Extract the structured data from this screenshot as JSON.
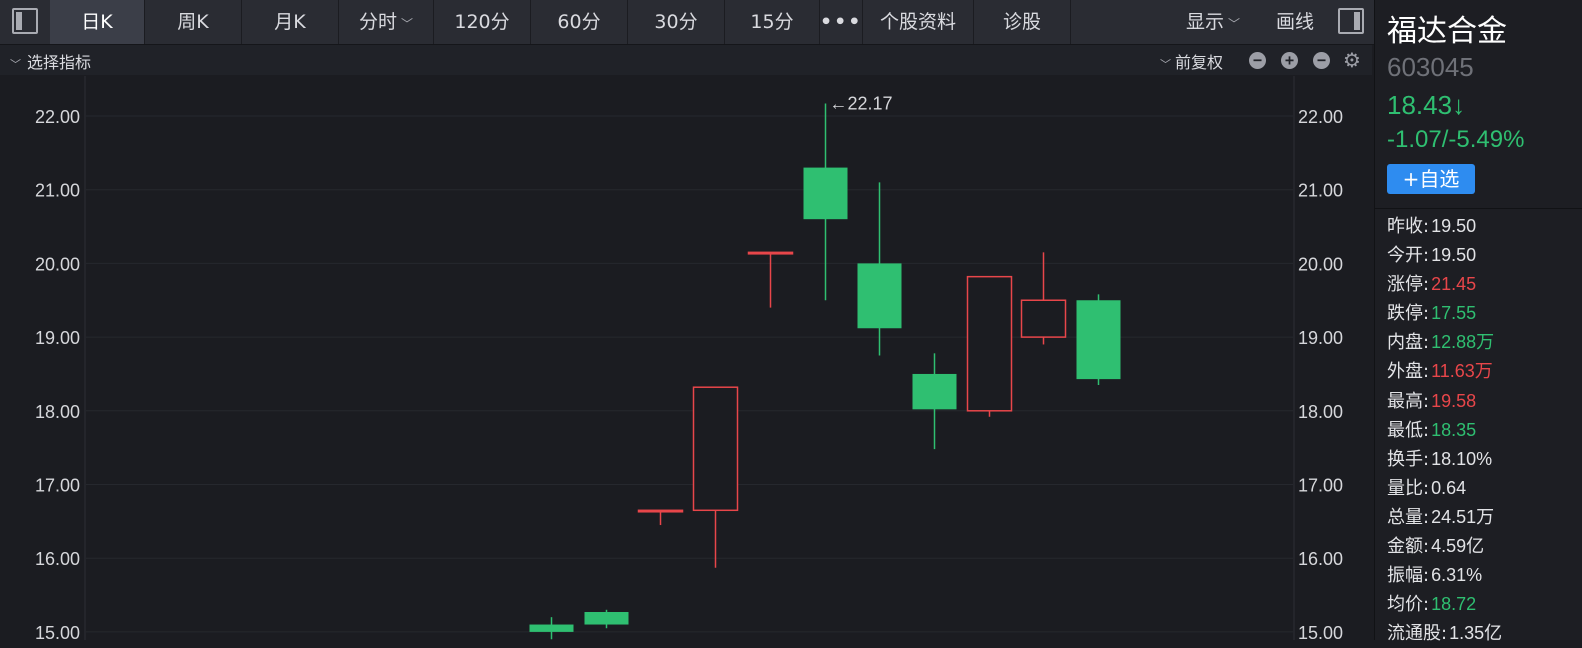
{
  "toolbar": {
    "tabs": [
      {
        "label": "日K"
      },
      {
        "label": "周K"
      },
      {
        "label": "月K"
      },
      {
        "label": "分时"
      },
      {
        "label": "120分"
      },
      {
        "label": "60分"
      },
      {
        "label": "30分"
      },
      {
        "label": "15分"
      },
      {
        "label": "•••"
      },
      {
        "label": "个股资料"
      },
      {
        "label": "诊股"
      }
    ],
    "active_tab": "日K",
    "display_label": "显示",
    "draw_label": "画线"
  },
  "subbar": {
    "indicator_label": "选择指标",
    "adjust_label": "前复权"
  },
  "chart_data": {
    "type": "candlestick",
    "y_ticks": [
      "22.00",
      "21.00",
      "20.00",
      "19.00",
      "18.00",
      "17.00",
      "16.00",
      "15.00"
    ],
    "ylim": [
      15.0,
      22.5
    ],
    "grid": true,
    "up_color": "#e8464a",
    "down_color": "#2fbf71",
    "max_annotation": "←22.17",
    "candles": [
      {
        "open": 15.1,
        "close": 15.0,
        "high": 15.2,
        "low": 14.9
      },
      {
        "open": 15.27,
        "close": 15.1,
        "high": 15.3,
        "low": 15.05
      },
      {
        "open": 16.65,
        "close": 16.65,
        "high": 16.65,
        "low": 16.45
      },
      {
        "open": 16.65,
        "close": 18.32,
        "high": 18.32,
        "low": 15.87
      },
      {
        "open": 20.15,
        "close": 20.15,
        "high": 20.15,
        "low": 19.4
      },
      {
        "open": 21.3,
        "close": 20.6,
        "high": 22.17,
        "low": 19.5
      },
      {
        "open": 20.0,
        "close": 19.12,
        "high": 21.1,
        "low": 18.75
      },
      {
        "open": 18.5,
        "close": 18.02,
        "high": 18.78,
        "low": 17.48
      },
      {
        "open": 18.0,
        "close": 19.82,
        "high": 19.82,
        "low": 17.92
      },
      {
        "open": 19.0,
        "close": 19.5,
        "high": 20.15,
        "low": 18.9
      },
      {
        "open": 19.5,
        "close": 18.43,
        "high": 19.58,
        "low": 18.35
      }
    ]
  },
  "stock": {
    "name": "福达合金",
    "code": "603045",
    "price": "18.43↓",
    "change": "-1.07/-5.49%",
    "watch_label": "+自选"
  },
  "stats": [
    {
      "label": "昨收:",
      "value": "19.50",
      "tone": "neutral"
    },
    {
      "label": "今开:",
      "value": "19.50",
      "tone": "neutral"
    },
    {
      "label": "涨停:",
      "value": "21.45",
      "tone": "up"
    },
    {
      "label": "跌停:",
      "value": "17.55",
      "tone": "down"
    },
    {
      "label": "内盘:",
      "value": "12.88万",
      "tone": "down"
    },
    {
      "label": "外盘:",
      "value": "11.63万",
      "tone": "up"
    },
    {
      "label": "最高:",
      "value": "19.58",
      "tone": "up"
    },
    {
      "label": "最低:",
      "value": "18.35",
      "tone": "down"
    },
    {
      "label": "换手:",
      "value": "18.10%",
      "tone": "neutral"
    },
    {
      "label": "量比:",
      "value": "0.64",
      "tone": "neutral"
    },
    {
      "label": "总量:",
      "value": "24.51万",
      "tone": "neutral"
    },
    {
      "label": "金额:",
      "value": "4.59亿",
      "tone": "neutral"
    },
    {
      "label": "振幅:",
      "value": "6.31%",
      "tone": "neutral"
    },
    {
      "label": "均价:",
      "value": "18.72",
      "tone": "down"
    },
    {
      "label": "流通股:",
      "value": "1.35亿",
      "tone": "neutral"
    }
  ]
}
